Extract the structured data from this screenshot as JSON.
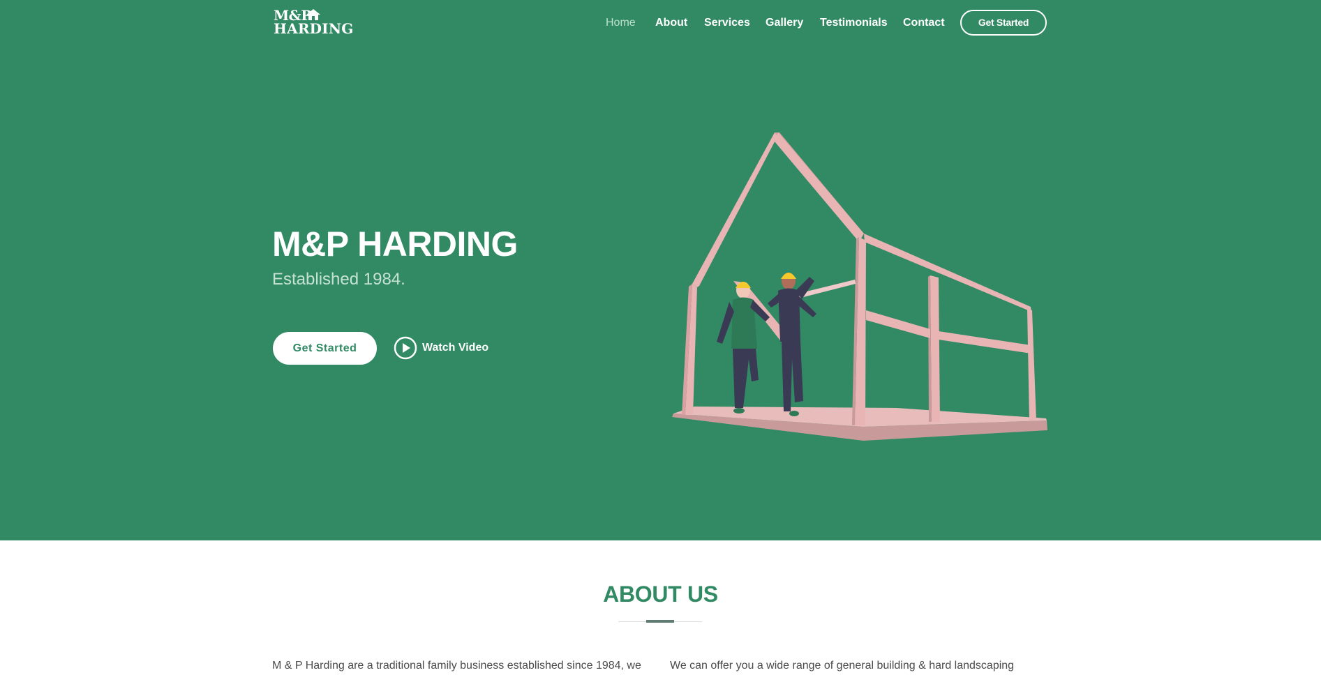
{
  "brand": {
    "logo_line1": "M&P",
    "logo_line2": "HARDING",
    "logo_icon": "house-icon"
  },
  "nav": {
    "items": [
      {
        "label": "Home",
        "active": true
      },
      {
        "label": "About",
        "active": false
      },
      {
        "label": "Services",
        "active": false
      },
      {
        "label": "Gallery",
        "active": false
      },
      {
        "label": "Testimonials",
        "active": false
      },
      {
        "label": "Contact",
        "active": false
      }
    ],
    "cta": "Get Started"
  },
  "hero": {
    "title": "M&P HARDING",
    "subtitle": "Established 1984.",
    "primary_button": "Get Started",
    "video_button": "Watch Video",
    "video_icon": "play-circle-icon",
    "illustration": "house-frame-builders-illustration"
  },
  "about": {
    "title": "ABOUT US",
    "col1": "M & P Harding are a traditional family business established since 1984, we",
    "col2": "We can offer you a wide range of general building & hard landscaping"
  },
  "colors": {
    "primary": "#318a64",
    "hero_subtitle": "#c7e2d4",
    "frame_pink": "#e8b4b4",
    "text": "#4a4a4a"
  }
}
